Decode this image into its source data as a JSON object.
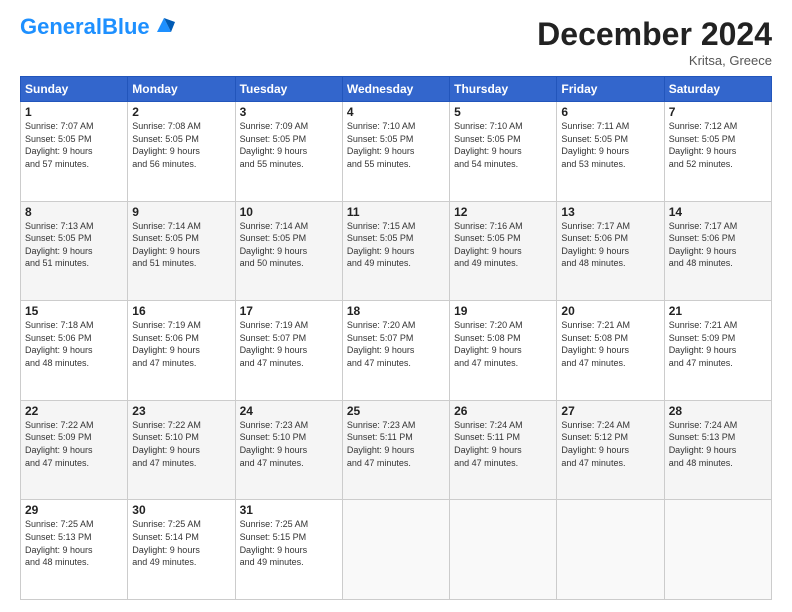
{
  "logo": {
    "part1": "General",
    "part2": "Blue"
  },
  "title": "December 2024",
  "subtitle": "Kritsa, Greece",
  "days_header": [
    "Sunday",
    "Monday",
    "Tuesday",
    "Wednesday",
    "Thursday",
    "Friday",
    "Saturday"
  ],
  "weeks": [
    [
      {
        "num": "1",
        "info": "Sunrise: 7:07 AM\nSunset: 5:05 PM\nDaylight: 9 hours\nand 57 minutes."
      },
      {
        "num": "2",
        "info": "Sunrise: 7:08 AM\nSunset: 5:05 PM\nDaylight: 9 hours\nand 56 minutes."
      },
      {
        "num": "3",
        "info": "Sunrise: 7:09 AM\nSunset: 5:05 PM\nDaylight: 9 hours\nand 55 minutes."
      },
      {
        "num": "4",
        "info": "Sunrise: 7:10 AM\nSunset: 5:05 PM\nDaylight: 9 hours\nand 55 minutes."
      },
      {
        "num": "5",
        "info": "Sunrise: 7:10 AM\nSunset: 5:05 PM\nDaylight: 9 hours\nand 54 minutes."
      },
      {
        "num": "6",
        "info": "Sunrise: 7:11 AM\nSunset: 5:05 PM\nDaylight: 9 hours\nand 53 minutes."
      },
      {
        "num": "7",
        "info": "Sunrise: 7:12 AM\nSunset: 5:05 PM\nDaylight: 9 hours\nand 52 minutes."
      }
    ],
    [
      {
        "num": "8",
        "info": "Sunrise: 7:13 AM\nSunset: 5:05 PM\nDaylight: 9 hours\nand 51 minutes."
      },
      {
        "num": "9",
        "info": "Sunrise: 7:14 AM\nSunset: 5:05 PM\nDaylight: 9 hours\nand 51 minutes."
      },
      {
        "num": "10",
        "info": "Sunrise: 7:14 AM\nSunset: 5:05 PM\nDaylight: 9 hours\nand 50 minutes."
      },
      {
        "num": "11",
        "info": "Sunrise: 7:15 AM\nSunset: 5:05 PM\nDaylight: 9 hours\nand 49 minutes."
      },
      {
        "num": "12",
        "info": "Sunrise: 7:16 AM\nSunset: 5:05 PM\nDaylight: 9 hours\nand 49 minutes."
      },
      {
        "num": "13",
        "info": "Sunrise: 7:17 AM\nSunset: 5:06 PM\nDaylight: 9 hours\nand 48 minutes."
      },
      {
        "num": "14",
        "info": "Sunrise: 7:17 AM\nSunset: 5:06 PM\nDaylight: 9 hours\nand 48 minutes."
      }
    ],
    [
      {
        "num": "15",
        "info": "Sunrise: 7:18 AM\nSunset: 5:06 PM\nDaylight: 9 hours\nand 48 minutes."
      },
      {
        "num": "16",
        "info": "Sunrise: 7:19 AM\nSunset: 5:06 PM\nDaylight: 9 hours\nand 47 minutes."
      },
      {
        "num": "17",
        "info": "Sunrise: 7:19 AM\nSunset: 5:07 PM\nDaylight: 9 hours\nand 47 minutes."
      },
      {
        "num": "18",
        "info": "Sunrise: 7:20 AM\nSunset: 5:07 PM\nDaylight: 9 hours\nand 47 minutes."
      },
      {
        "num": "19",
        "info": "Sunrise: 7:20 AM\nSunset: 5:08 PM\nDaylight: 9 hours\nand 47 minutes."
      },
      {
        "num": "20",
        "info": "Sunrise: 7:21 AM\nSunset: 5:08 PM\nDaylight: 9 hours\nand 47 minutes."
      },
      {
        "num": "21",
        "info": "Sunrise: 7:21 AM\nSunset: 5:09 PM\nDaylight: 9 hours\nand 47 minutes."
      }
    ],
    [
      {
        "num": "22",
        "info": "Sunrise: 7:22 AM\nSunset: 5:09 PM\nDaylight: 9 hours\nand 47 minutes."
      },
      {
        "num": "23",
        "info": "Sunrise: 7:22 AM\nSunset: 5:10 PM\nDaylight: 9 hours\nand 47 minutes."
      },
      {
        "num": "24",
        "info": "Sunrise: 7:23 AM\nSunset: 5:10 PM\nDaylight: 9 hours\nand 47 minutes."
      },
      {
        "num": "25",
        "info": "Sunrise: 7:23 AM\nSunset: 5:11 PM\nDaylight: 9 hours\nand 47 minutes."
      },
      {
        "num": "26",
        "info": "Sunrise: 7:24 AM\nSunset: 5:11 PM\nDaylight: 9 hours\nand 47 minutes."
      },
      {
        "num": "27",
        "info": "Sunrise: 7:24 AM\nSunset: 5:12 PM\nDaylight: 9 hours\nand 47 minutes."
      },
      {
        "num": "28",
        "info": "Sunrise: 7:24 AM\nSunset: 5:13 PM\nDaylight: 9 hours\nand 48 minutes."
      }
    ],
    [
      {
        "num": "29",
        "info": "Sunrise: 7:25 AM\nSunset: 5:13 PM\nDaylight: 9 hours\nand 48 minutes."
      },
      {
        "num": "30",
        "info": "Sunrise: 7:25 AM\nSunset: 5:14 PM\nDaylight: 9 hours\nand 49 minutes."
      },
      {
        "num": "31",
        "info": "Sunrise: 7:25 AM\nSunset: 5:15 PM\nDaylight: 9 hours\nand 49 minutes."
      },
      {
        "num": "",
        "info": ""
      },
      {
        "num": "",
        "info": ""
      },
      {
        "num": "",
        "info": ""
      },
      {
        "num": "",
        "info": ""
      }
    ]
  ]
}
